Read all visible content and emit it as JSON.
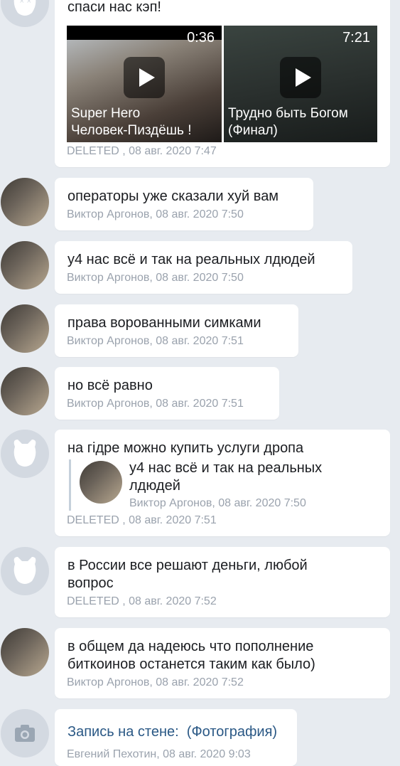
{
  "messages": [
    {
      "text": "спаси нас кэп!",
      "meta": "DELETED , 08 авг. 2020 7:47",
      "videos": [
        {
          "duration": "0:36",
          "title_line1": "Super Hero",
          "title_line2": "Человек-Пиздёшь !"
        },
        {
          "duration": "7:21",
          "title_line1": "Трудно быть Богом",
          "title_line2": "(Финал)"
        }
      ]
    },
    {
      "text": "операторы уже сказали хуй вам",
      "meta": "Виктор Аргонов, 08 авг. 2020 7:50"
    },
    {
      "text": "у4 нас всё и так на реальных лдюдей",
      "meta": "Виктор Аргонов, 08 авг. 2020 7:50"
    },
    {
      "text": "права ворованными симками",
      "meta": "Виктор Аргонов, 08 авг. 2020 7:51"
    },
    {
      "text": "но всё равно",
      "meta": "Виктор Аргонов, 08 авг. 2020 7:51"
    },
    {
      "text": "на гідре можно купить услуги дропа",
      "meta": "DELETED , 08 авг. 2020 7:51",
      "quote": {
        "line1": "у4 нас всё и так на реальных",
        "line2": "лдюдей",
        "meta": "Виктор Аргонов, 08 авг. 2020 7:50"
      }
    },
    {
      "line1": "в России все решают деньги, любой",
      "line2": "вопрос",
      "meta": "DELETED , 08 авг. 2020 7:52"
    },
    {
      "line1": "в общем да надеюсь что пополнение",
      "line2": "биткоинов останется таким как было)",
      "meta": "Виктор Аргонов, 08 авг. 2020 7:52"
    },
    {
      "link": "Запись на стене:  (Фотография)",
      "meta": "Евгений Пехотин, 08 авг. 2020 9:03"
    }
  ]
}
